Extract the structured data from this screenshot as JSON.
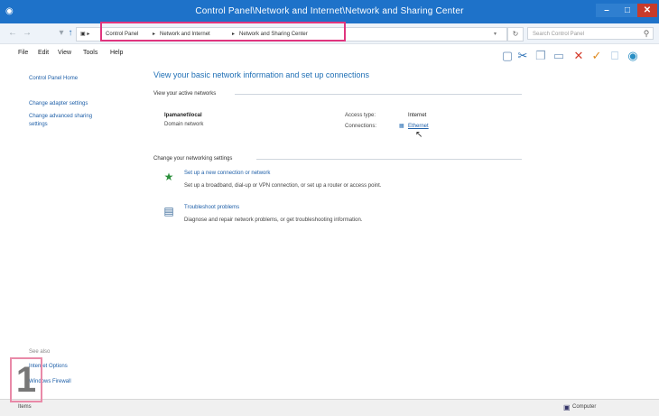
{
  "window": {
    "title": "Control Panel\\Network and Internet\\Network and Sharing Center",
    "minimize": "–",
    "maximize": "□",
    "close": "✕"
  },
  "address": {
    "breadcrumbs": [
      "Control Panel",
      "Network and Internet",
      "Network and Sharing Center"
    ],
    "search_placeholder": "Search Control Panel"
  },
  "menu": [
    "File",
    "Edit",
    "View",
    "Tools",
    "Help"
  ],
  "sidebar": {
    "home": "Control Panel Home",
    "links": [
      "Change adapter settings",
      "Change advanced sharing",
      "settings"
    ],
    "see_also_heading": "See also",
    "see_also": [
      "Internet Options",
      "Windows Firewall"
    ]
  },
  "main": {
    "title": "View your basic network information and set up connections",
    "active_networks_label": "View your active networks",
    "network_name": "Ipamanet\\local",
    "network_type": "Domain network",
    "access_type_label": "Access type:",
    "access_type_value": "Internet",
    "connections_label": "Connections:",
    "connections_value": "Ethernet",
    "change_settings_label": "Change your networking settings",
    "tasks": [
      {
        "link": "Set up a new connection or network",
        "desc": "Set up a broadband, dial-up or VPN connection, or set up a router or access point."
      },
      {
        "link": "Troubleshoot problems",
        "desc": "Diagnose and repair network problems, or get troubleshooting information."
      }
    ]
  },
  "status": {
    "left": "Items",
    "right": "Computer"
  },
  "step_marker": "1",
  "colors": {
    "titlebar": "#1e72c9",
    "link": "#1e5fa8",
    "highlight": "#e0357e"
  }
}
